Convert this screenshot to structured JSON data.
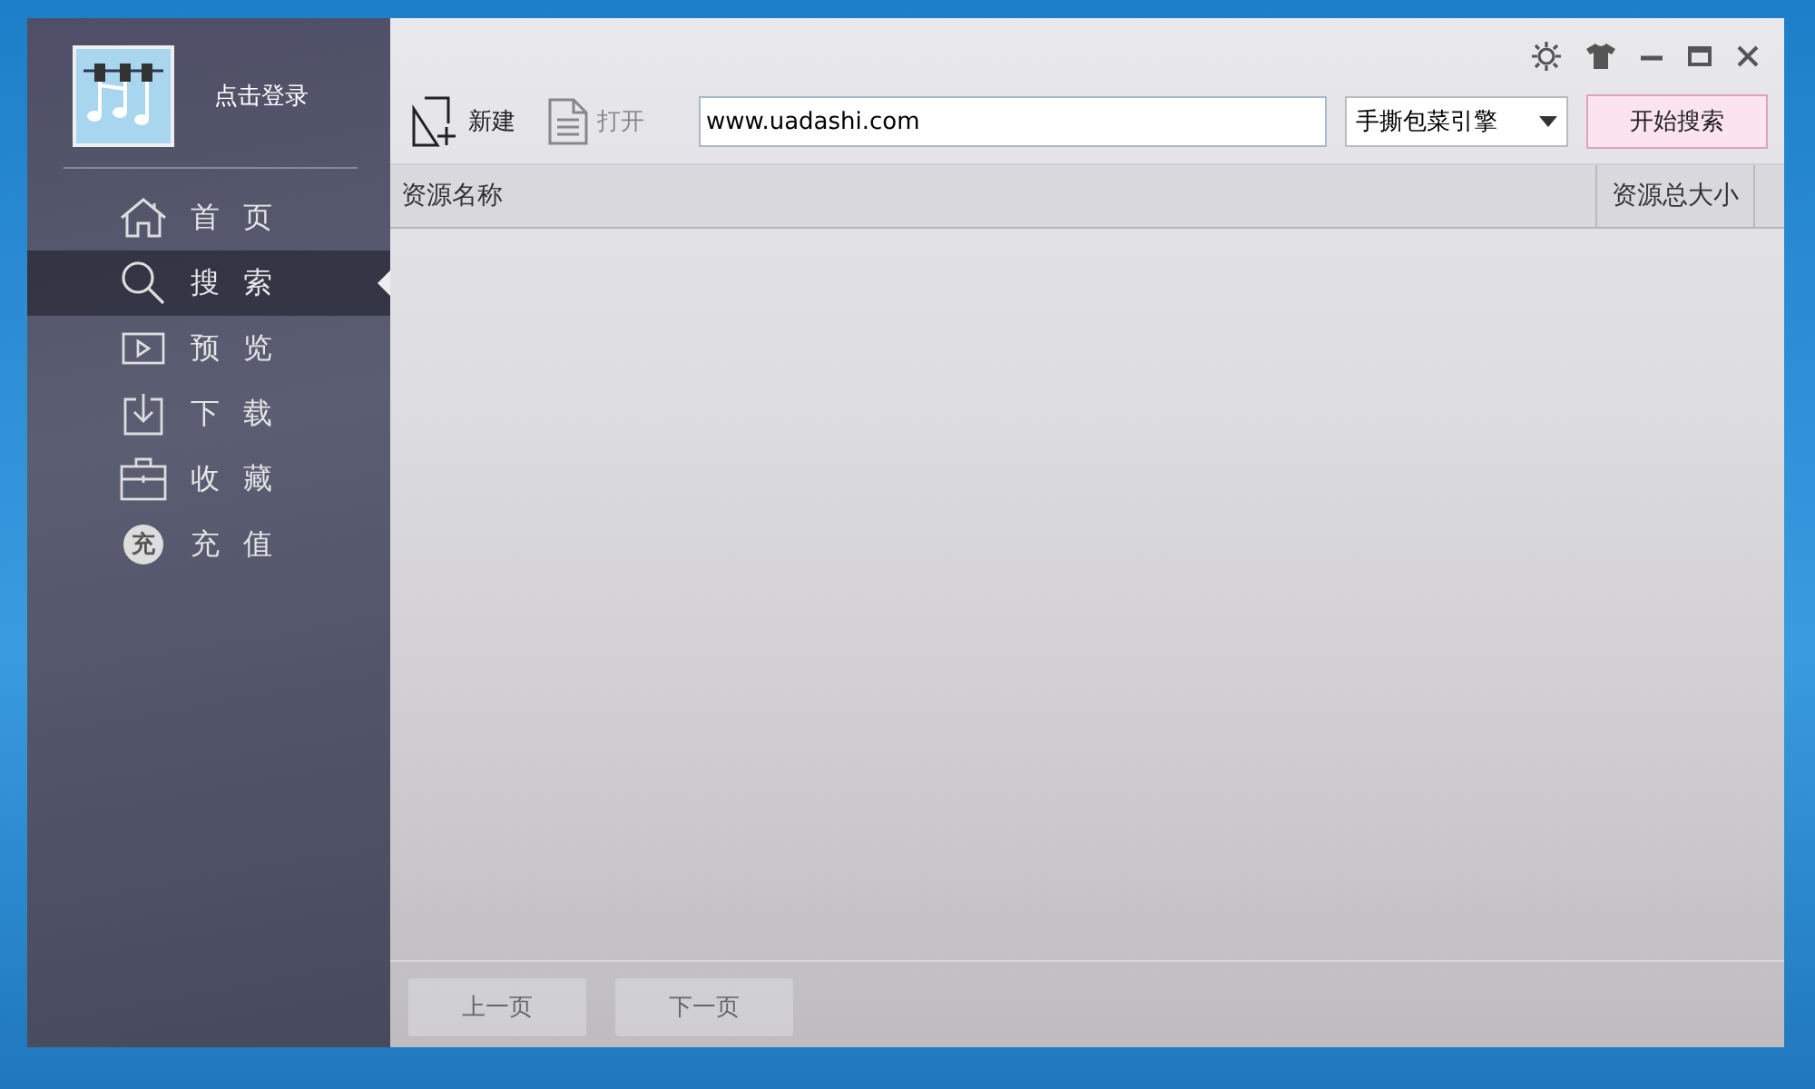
{
  "user": {
    "login_label": "点击登录"
  },
  "nav": [
    {
      "kind": "home",
      "label": "首 页",
      "selected": false
    },
    {
      "kind": "search",
      "label": "搜 索",
      "selected": true
    },
    {
      "kind": "preview",
      "label": "预 览",
      "selected": false
    },
    {
      "kind": "download",
      "label": "下 载",
      "selected": false
    },
    {
      "kind": "favorites",
      "label": "收 藏",
      "selected": false
    },
    {
      "kind": "recharge",
      "label": "充 值",
      "selected": false,
      "glyph": "充"
    }
  ],
  "toolbar": [
    {
      "kind": "new",
      "label": "新建",
      "disabled": false
    },
    {
      "kind": "open",
      "label": "打开",
      "disabled": true
    }
  ],
  "search": {
    "value": "www.uadashi.com",
    "engine": "手撕包菜引擎",
    "button": "开始搜索"
  },
  "table": {
    "columns": [
      "资源名称",
      "资源总大小"
    ]
  },
  "pager": [
    {
      "label": "上一页",
      "disabled": true
    },
    {
      "label": "下一页",
      "disabled": true
    }
  ]
}
